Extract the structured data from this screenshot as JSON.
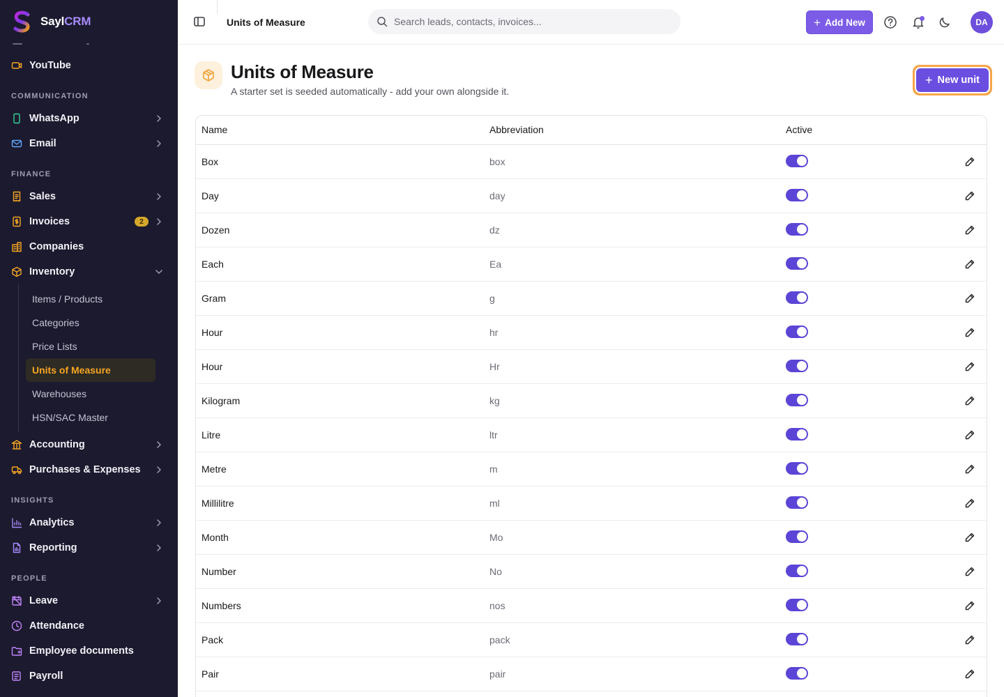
{
  "brand": {
    "name_main": "Sayl",
    "name_accent": "CRM"
  },
  "sidebar": {
    "top_items": [
      {
        "label": "YouTube",
        "icon": "video-icon"
      }
    ],
    "sections": [
      {
        "title": "COMMUNICATION",
        "items": [
          {
            "label": "WhatsApp",
            "icon": "phone-icon",
            "chevron": true
          },
          {
            "label": "Email",
            "icon": "mail-icon",
            "chevron": true
          }
        ]
      },
      {
        "title": "FINANCE",
        "items": [
          {
            "label": "Sales",
            "icon": "receipt-icon",
            "chevron": true
          },
          {
            "label": "Invoices",
            "icon": "invoice-icon",
            "chevron": true,
            "badge": "2"
          },
          {
            "label": "Companies",
            "icon": "building-icon",
            "chevron": false
          },
          {
            "label": "Inventory",
            "icon": "box-icon",
            "chevron": true,
            "expanded": true
          }
        ]
      }
    ],
    "inventory_sub": [
      {
        "label": "Items / Products",
        "active": false
      },
      {
        "label": "Categories",
        "active": false
      },
      {
        "label": "Price Lists",
        "active": false
      },
      {
        "label": "Units of Measure",
        "active": true
      },
      {
        "label": "Warehouses",
        "active": false
      },
      {
        "label": "HSN/SAC Master",
        "active": false
      }
    ],
    "finance_more": [
      {
        "label": "Accounting",
        "icon": "bank-icon",
        "chevron": true
      },
      {
        "label": "Purchases & Expenses",
        "icon": "truck-icon",
        "chevron": true
      }
    ],
    "sections2": [
      {
        "title": "INSIGHTS",
        "items": [
          {
            "label": "Analytics",
            "icon": "bar-chart-icon",
            "chevron": true
          },
          {
            "label": "Reporting",
            "icon": "report-icon",
            "chevron": true
          }
        ]
      },
      {
        "title": "PEOPLE",
        "items": [
          {
            "label": "Leave",
            "icon": "calendar-off-icon",
            "chevron": true
          },
          {
            "label": "Attendance",
            "icon": "clock-icon",
            "chevron": false
          },
          {
            "label": "Employee documents",
            "icon": "folder-icon",
            "chevron": false
          },
          {
            "label": "Payroll",
            "icon": "wallet-icon",
            "chevron": false
          }
        ]
      }
    ]
  },
  "topbar": {
    "breadcrumb": "Units of Measure",
    "search_placeholder": "Search leads, contacts, invoices...",
    "add_new_label": "Add New",
    "avatar_initials": "DA"
  },
  "page": {
    "title": "Units of Measure",
    "subtitle": "A starter set is seeded automatically - add your own alongside it.",
    "new_unit_label": "New unit"
  },
  "table": {
    "headers": [
      "Name",
      "Abbreviation",
      "Active"
    ],
    "rows": [
      {
        "name": "Box",
        "abbr": "box",
        "active": true
      },
      {
        "name": "Day",
        "abbr": "day",
        "active": true
      },
      {
        "name": "Dozen",
        "abbr": "dz",
        "active": true
      },
      {
        "name": "Each",
        "abbr": "Ea",
        "active": true
      },
      {
        "name": "Gram",
        "abbr": "g",
        "active": true
      },
      {
        "name": "Hour",
        "abbr": "hr",
        "active": true
      },
      {
        "name": "Hour",
        "abbr": "Hr",
        "active": true
      },
      {
        "name": "Kilogram",
        "abbr": "kg",
        "active": true
      },
      {
        "name": "Litre",
        "abbr": "ltr",
        "active": true
      },
      {
        "name": "Metre",
        "abbr": "m",
        "active": true
      },
      {
        "name": "Millilitre",
        "abbr": "ml",
        "active": true
      },
      {
        "name": "Month",
        "abbr": "Mo",
        "active": true
      },
      {
        "name": "Number",
        "abbr": "No",
        "active": true
      },
      {
        "name": "Numbers",
        "abbr": "nos",
        "active": true
      },
      {
        "name": "Pack",
        "abbr": "pack",
        "active": true
      },
      {
        "name": "Pair",
        "abbr": "pair",
        "active": true
      }
    ]
  },
  "colors": {
    "accent": "#6a4ee0",
    "sidebar_bg": "#1c1a2e",
    "active_sub": "#f5a623",
    "badge": "#d4a72c"
  }
}
